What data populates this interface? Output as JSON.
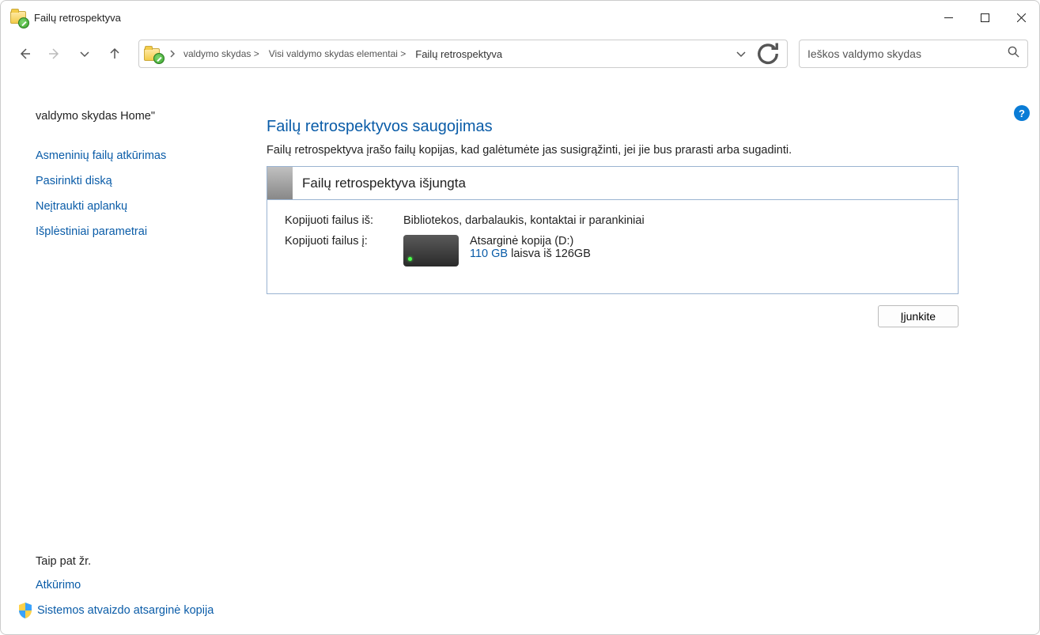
{
  "window": {
    "title": "Failų retrospektyva"
  },
  "breadcrumb": {
    "item1": "valdymo skydas >",
    "item2": "Visi valdymo skydas elementai >",
    "item3": "Failų retrospektyva"
  },
  "search": {
    "placeholder": "Ieškos valdymo skydas"
  },
  "sidebar": {
    "home": "valdymo skydas Home\"",
    "links": [
      "Asmeninių failų atkūrimas",
      "Pasirinkti diską",
      "Neįtraukti aplankų",
      "Išplėstiniai parametrai"
    ],
    "see_also_title": "Taip pat žr.",
    "see_also": [
      "Atkūrimo",
      "Sistemos atvaizdo atsarginė kopija"
    ]
  },
  "main": {
    "heading": "Failų retrospektyvos saugojimas",
    "description": "Failų retrospektyva įrašo failų kopijas, kad galėtumėte jas susigrąžinti, jei jie bus prarasti arba sugadinti.",
    "status_title": "Failų retrospektyva išjungta",
    "copy_from_label": "Kopijuoti failus iš:",
    "copy_from_value": "Bibliotekos, darbalaukis, kontaktai ir parankiniai",
    "copy_to_label": "Kopijuoti failus į:",
    "drive_name": "Atsarginė kopija (D:)",
    "free_space": "110 GB",
    "space_tail": " laisva iš 126GB",
    "enable_button": "Įjunkite"
  },
  "help": "?"
}
